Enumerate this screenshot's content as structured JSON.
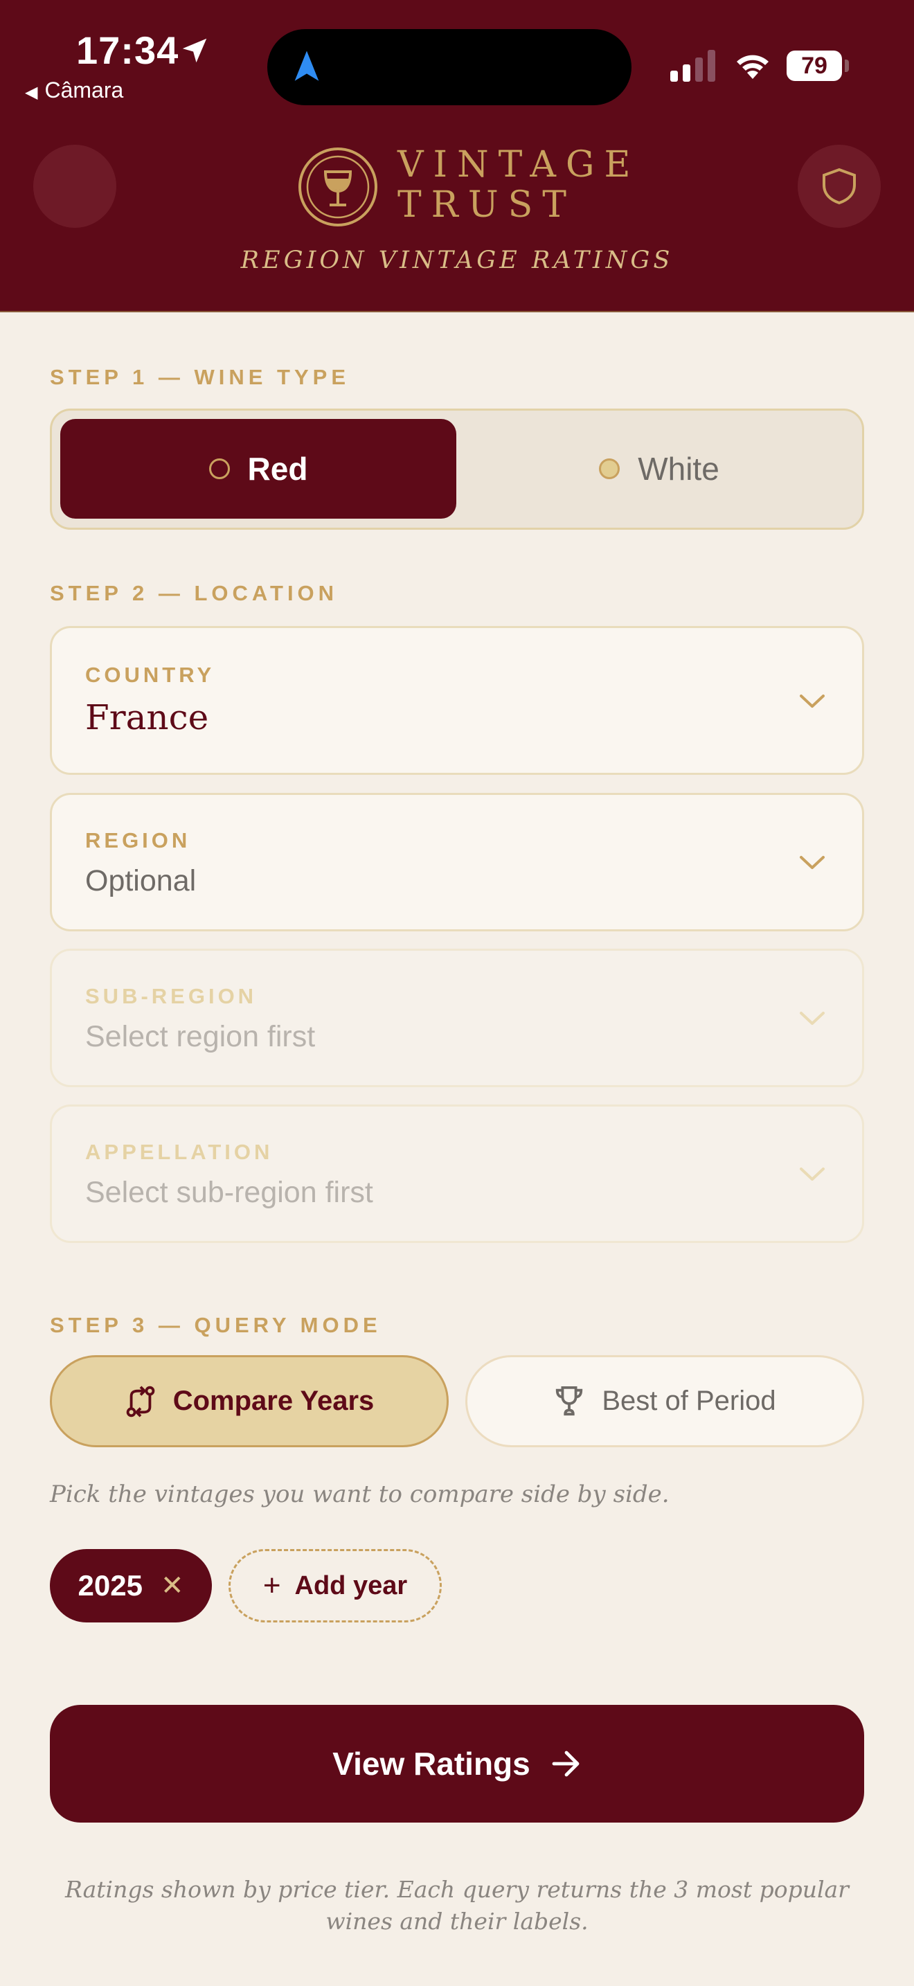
{
  "status_bar": {
    "time": "17:34",
    "back_label": "Câmara",
    "battery": "79"
  },
  "header": {
    "brand_line1": "VINTAGE",
    "brand_line2": "TRUST",
    "tagline": "REGION VINTAGE RATINGS"
  },
  "step1": {
    "label": "STEP 1 — WINE TYPE",
    "options": [
      {
        "label": "Red",
        "selected": true
      },
      {
        "label": "White",
        "selected": false
      }
    ]
  },
  "step2": {
    "label": "STEP 2 — LOCATION",
    "country": {
      "label": "COUNTRY",
      "value": "France"
    },
    "region": {
      "label": "REGION",
      "value": "Optional"
    },
    "subregion": {
      "label": "SUB-REGION",
      "value": "Select region first",
      "disabled": true
    },
    "appellation": {
      "label": "APPELLATION",
      "value": "Select sub-region first",
      "disabled": true
    }
  },
  "step3": {
    "label": "STEP 3 — QUERY MODE",
    "modes": [
      {
        "label": "Compare Years",
        "icon": "compare-arrows-icon",
        "selected": true
      },
      {
        "label": "Best of Period",
        "icon": "trophy-icon",
        "selected": false
      }
    ],
    "hint": "Pick the vintages you want to compare side by side.",
    "years": [
      "2025"
    ],
    "add_year_label": "Add year"
  },
  "cta": {
    "label": "View Ratings"
  },
  "footnote": "Ratings shown by price tier. Each query returns the 3 most popular wines and their labels.",
  "colors": {
    "burgundy": "#5e0a18",
    "gold": "#c9a15e",
    "cream": "#f5efe7"
  }
}
